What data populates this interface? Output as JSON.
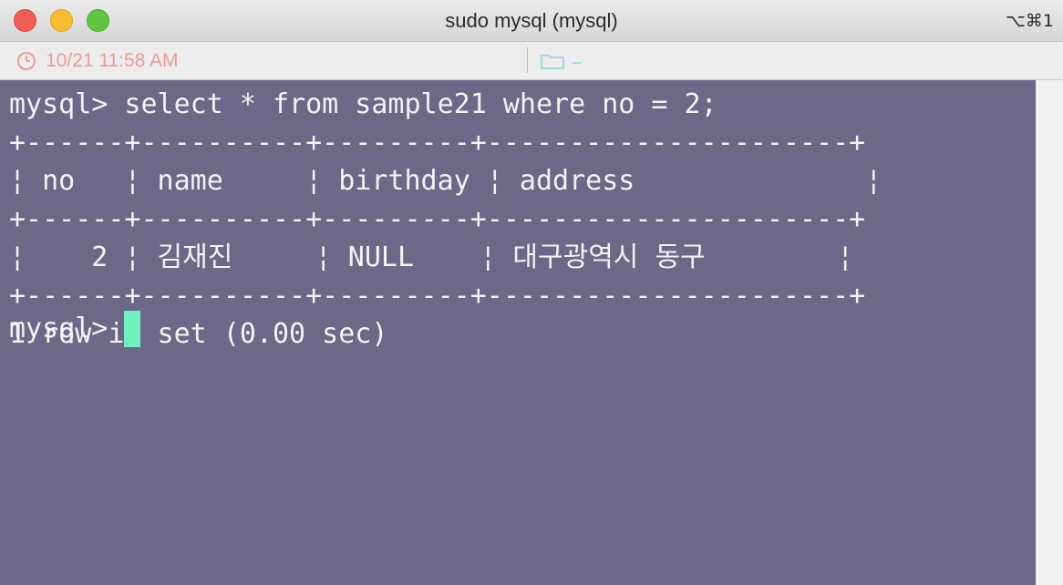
{
  "window": {
    "title": "sudo mysql (mysql)",
    "shortcut": "⌥⌘1"
  },
  "infobar": {
    "timestamp": "10/21 11:58 AM",
    "clock_icon": "clock-icon",
    "folder_icon": "folder-icon"
  },
  "terminal": {
    "lines": [
      "mysql> select * from sample21 where no = 2;",
      "+------+----------+---------+----------------------+",
      "¦ no   ¦ name     ¦ birthday ¦ address              ¦",
      "+------+----------+---------+----------------------+",
      "¦    2 ¦ 김재진     ¦ NULL    ¦ 대구광역시 동구        ¦",
      "+------+----------+---------+----------------------+",
      "1 row in set (0.00 sec)",
      ""
    ],
    "prompt": "mysql> ",
    "cursor_color": "#6ef0bf",
    "background_color": "#6d6888"
  }
}
